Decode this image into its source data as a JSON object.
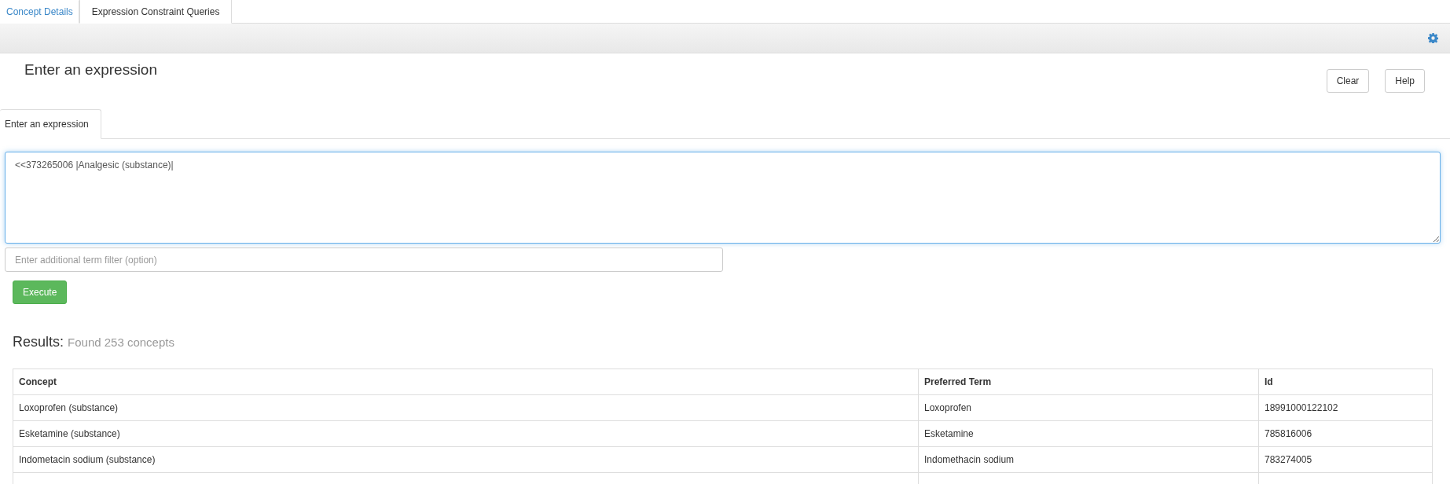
{
  "tabs": [
    {
      "label": "Concept Details",
      "selected": false
    },
    {
      "label": "Expression Constraint Queries",
      "selected": true
    }
  ],
  "heading": "Enter an expression",
  "buttons": [
    "Clear",
    "Help"
  ],
  "subtabs": [
    {
      "label": "Enter an expression",
      "selected": true
    }
  ],
  "expression": {
    "value": "<<373265006 |Analgesic (substance)|"
  },
  "filter": {
    "placeholder": "Enter additional term filter (option)"
  },
  "execute": "Execute",
  "results": {
    "label": "Results:",
    "summary": "Found 253 concepts"
  },
  "table": {
    "columns": [
      "Concept",
      "Preferred Term",
      "Id"
    ],
    "rows": [
      [
        "Loxoprofen (substance)",
        "Loxoprofen",
        "18991000122102"
      ],
      [
        "Esketamine (substance)",
        "Esketamine",
        "785816006"
      ],
      [
        "Indometacin sodium (substance)",
        "Indomethacin sodium",
        "783274005"
      ]
    ]
  }
}
